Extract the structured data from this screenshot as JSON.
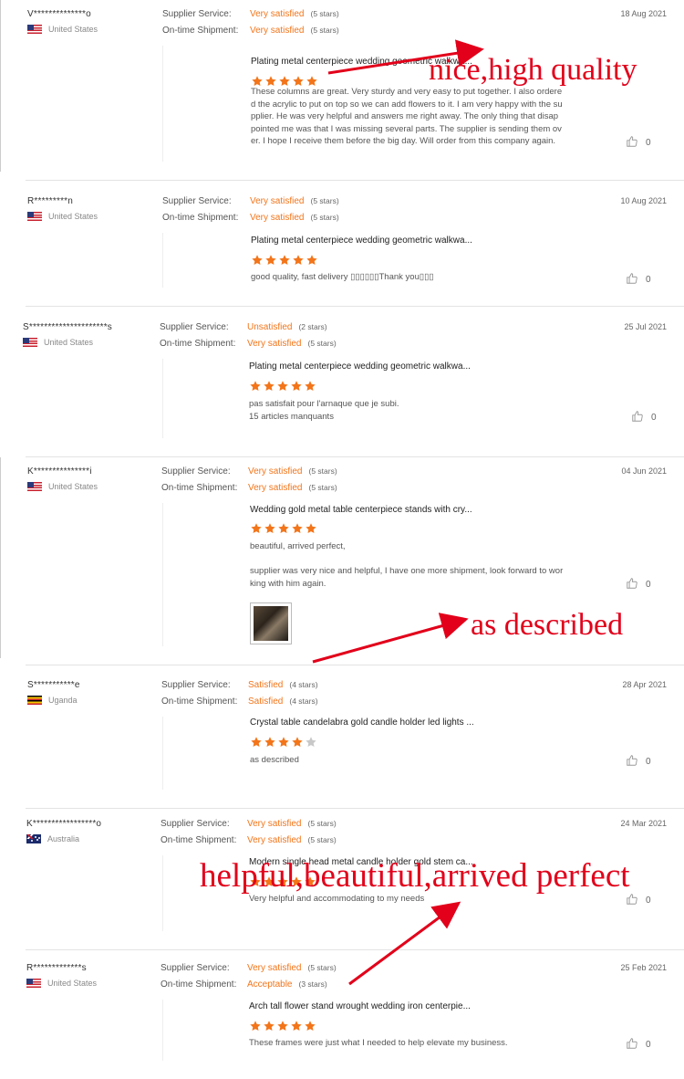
{
  "labels": {
    "supplier_service": "Supplier Service:",
    "ontime_shipment": "On-time Shipment:"
  },
  "colors": {
    "accent": "#f3751a",
    "annotation": "#e2001a",
    "star_empty": "#c8c8c8"
  },
  "reviews": [
    {
      "name": "V**************o",
      "country": "United States",
      "flag": "us",
      "date": "18 Aug 2021",
      "supplier_rating": "Very satisfied",
      "supplier_stars": "(5 stars)",
      "shipment_rating": "Very satisfied",
      "shipment_stars": "(5 stars)",
      "product": "Plating metal centerpiece wedding geometric walkwa...",
      "stars": 5,
      "comment_lines": [
        "These columns are great.  Very sturdy and very easy to put together.  I also ordere",
        "d the acrylic to put on top so we can add flowers to it.  I am very happy with the su",
        "pplier.  He was very helpful and answers me right away.  The only thing that disap",
        "pointed me was that I was missing several parts.  The supplier is sending them ov",
        "er.  I hope I receive them before the big day.  Will order from this company again."
      ],
      "likes": "0"
    },
    {
      "name": "R*********n",
      "country": "United States",
      "flag": "us",
      "date": "10 Aug 2021",
      "supplier_rating": "Very satisfied",
      "supplier_stars": "(5 stars)",
      "shipment_rating": "Very satisfied",
      "shipment_stars": "(5 stars)",
      "product": "Plating metal centerpiece wedding geometric walkwa...",
      "stars": 5,
      "comment_lines": [
        "good quality, fast delivery ▯▯▯▯▯▯Thank you▯▯▯"
      ],
      "likes": "0"
    },
    {
      "name": "S*********************s",
      "country": "United States",
      "flag": "us",
      "date": "25 Jul 2021",
      "supplier_rating": "Unsatisfied",
      "supplier_stars": "(2 stars)",
      "shipment_rating": "Very satisfied",
      "shipment_stars": "(5 stars)",
      "product": "Plating metal centerpiece wedding geometric walkwa...",
      "stars": 5,
      "comment_lines": [
        "pas satisfait pour l'arnaque que je subi.",
        "15 articles manquants"
      ],
      "likes": "0"
    },
    {
      "name": "K***************i",
      "country": "United States",
      "flag": "us",
      "date": "04 Jun 2021",
      "supplier_rating": "Very satisfied",
      "supplier_stars": "(5 stars)",
      "shipment_rating": "Very satisfied",
      "shipment_stars": "(5 stars)",
      "product": "Wedding gold metal table centerpiece stands with cry...",
      "stars": 5,
      "comment_lines": [
        "beautiful, arrived perfect,",
        "",
        "supplier was very nice and helpful, I have one more shipment, look forward to wor",
        "king with him again."
      ],
      "likes": "0",
      "has_image": true
    },
    {
      "name": "S***********e",
      "country": "Uganda",
      "flag": "ug",
      "date": "28 Apr 2021",
      "supplier_rating": "Satisfied",
      "supplier_stars": "(4 stars)",
      "shipment_rating": "Satisfied",
      "shipment_stars": "(4 stars)",
      "product": "Crystal table candelabra gold candle holder led lights ...",
      "stars": 4,
      "comment_lines": [
        "as described"
      ],
      "likes": "0"
    },
    {
      "name": "K*****************o",
      "country": "Australia",
      "flag": "au",
      "date": "24 Mar 2021",
      "supplier_rating": "Very satisfied",
      "supplier_stars": "(5 stars)",
      "shipment_rating": "Very satisfied",
      "shipment_stars": "(5 stars)",
      "product": "Modern single head metal candle holder gold stem ca...",
      "stars": 5,
      "comment_lines": [
        "Very helpful and accommodating to my needs"
      ],
      "likes": "0"
    },
    {
      "name": "R*************s",
      "country": "United States",
      "flag": "us",
      "date": "25 Feb 2021",
      "supplier_rating": "Very satisfied",
      "supplier_stars": "(5 stars)",
      "shipment_rating": "Acceptable",
      "shipment_stars": "(3 stars)",
      "product": "Arch tall flower stand wrought wedding iron centerpie...",
      "stars": 5,
      "comment_lines": [
        "These frames were just what I needed to help elevate my business."
      ],
      "likes": "0"
    }
  ],
  "annotations": {
    "a1": "nice,high quality",
    "a2": "as described",
    "a3": "helpful,beautiful,arrived perfect"
  }
}
